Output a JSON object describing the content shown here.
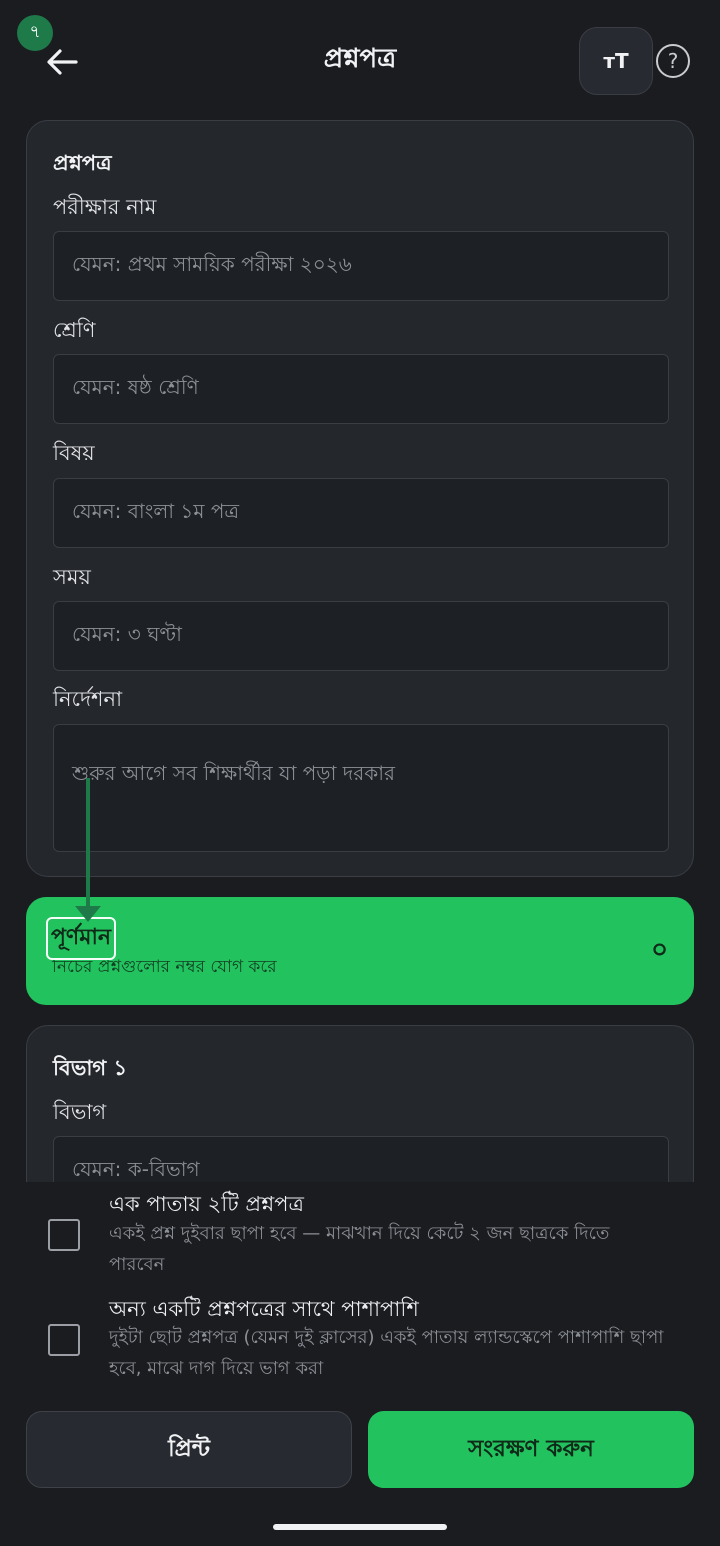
{
  "status": {
    "badge": "৭"
  },
  "header": {
    "title": "প্রশ্নপত্র",
    "font_button": "ᴛT",
    "help": "?"
  },
  "form": {
    "title": "প্রশ্নপত্র",
    "fields": [
      {
        "label": "পরীক্ষার নাম",
        "placeholder": "যেমন: প্রথম সাময়িক পরীক্ষা ২০২৬"
      },
      {
        "label": "শ্রেণি",
        "placeholder": "যেমন: ষষ্ঠ শ্রেণি"
      },
      {
        "label": "বিষয়",
        "placeholder": "যেমন: বাংলা ১ম পত্র"
      },
      {
        "label": "সময়",
        "placeholder": "যেমন: ৩ ঘণ্টা"
      },
      {
        "label": "নির্দেশনা",
        "placeholder": "শুরুর আগে সব শিক্ষার্থীর যা পড়া দরকার"
      }
    ]
  },
  "total_marks": {
    "title": "পূর্ণমান",
    "subtitle": "নিচের প্রশ্নগুলোর নম্বর যোগ করে",
    "value": "০"
  },
  "section": {
    "title": "বিভাগ ১",
    "label": "বিভাগ",
    "placeholder": "যেমন: ক-বিভাগ"
  },
  "options": [
    {
      "title": "এক পাতায় ২টি প্রশ্নপত্র",
      "description": "একই প্রশ্ন দুইবার ছাপা হবে — মাঝখান দিয়ে কেটে ২ জন ছাত্রকে দিতে পারবেন",
      "checked": false
    },
    {
      "title": "অন্য একটি প্রশ্নপত্রের সাথে পাশাপাশি",
      "description": "দুইটা ছোট প্রশ্নপত্র (যেমন দুই ক্লাসের) একই পাতায় ল্যান্ডস্কেপে পাশাপাশি ছাপা হবে, মাঝে দাগ দিয়ে ভাগ করা",
      "checked": false
    }
  ],
  "actions": {
    "print": "প্রিন্ট",
    "save": "সংরক্ষণ করুন"
  },
  "colors": {
    "accent": "#22c35e",
    "background": "#1a1c20",
    "card": "#24272c"
  }
}
